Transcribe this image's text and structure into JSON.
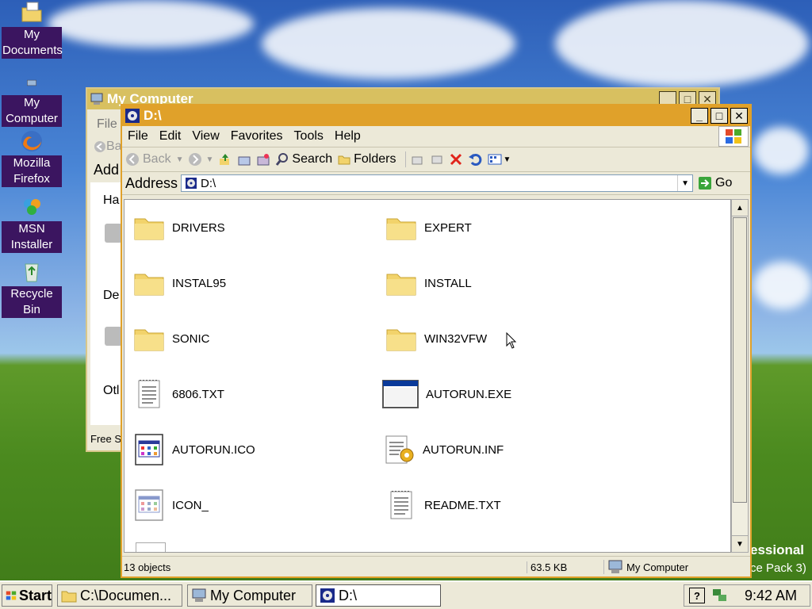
{
  "desktop": {
    "icons": [
      {
        "label": "My Documents",
        "icon": "folder-icon"
      },
      {
        "label": "My Computer",
        "icon": "computer-icon"
      },
      {
        "label": "Mozilla Firefox",
        "icon": "firefox-icon"
      },
      {
        "label": "MSN Installer",
        "icon": "msn-icon"
      },
      {
        "label": "Recycle Bin",
        "icon": "recycle-bin-icon"
      }
    ],
    "watermark_line1": "essional",
    "watermark_line2": "ce Pack 3)"
  },
  "back_window": {
    "title": "My Computer",
    "menu_fragment": "File",
    "back_fragment": "Ba",
    "address_fragment": "Add",
    "section1": "Ha",
    "section2": "De",
    "section3": "Otl",
    "status_fragment": "Free S"
  },
  "window": {
    "title": "D:\\",
    "menu": [
      "File",
      "Edit",
      "View",
      "Favorites",
      "Tools",
      "Help"
    ],
    "toolbar": {
      "back": "Back",
      "search": "Search",
      "folders": "Folders"
    },
    "address": {
      "label": "Address",
      "value": "D:\\",
      "go": "Go"
    },
    "files": [
      {
        "name": "DRIVERS",
        "icon": "folder-icon"
      },
      {
        "name": "EXPERT",
        "icon": "folder-icon"
      },
      {
        "name": "INSTAL95",
        "icon": "folder-icon"
      },
      {
        "name": "INSTALL",
        "icon": "folder-icon"
      },
      {
        "name": "SONIC",
        "icon": "folder-icon"
      },
      {
        "name": "WIN32VFW",
        "icon": "folder-icon"
      },
      {
        "name": "6806.TXT",
        "icon": "text-file-icon"
      },
      {
        "name": "AUTORUN.EXE",
        "icon": "exe-file-icon"
      },
      {
        "name": "AUTORUN.ICO",
        "icon": "ico-file-icon"
      },
      {
        "name": "AUTORUN.INF",
        "icon": "inf-file-icon"
      },
      {
        "name": "ICON_",
        "icon": "ico-file-icon"
      },
      {
        "name": "README.TXT",
        "icon": "text-file-icon"
      }
    ],
    "status": {
      "objects": "13 objects",
      "size": "63.5 KB",
      "location": "My Computer"
    }
  },
  "taskbar": {
    "start": "Start",
    "tasks": [
      "C:\\Documen...",
      "My Computer",
      "D:\\"
    ],
    "clock": "9:42 AM"
  },
  "colors": {
    "titlebar_active": "#e0a12a",
    "titlebar_inactive": "#d8c060",
    "desktop_label_bg": "#3b1560"
  }
}
